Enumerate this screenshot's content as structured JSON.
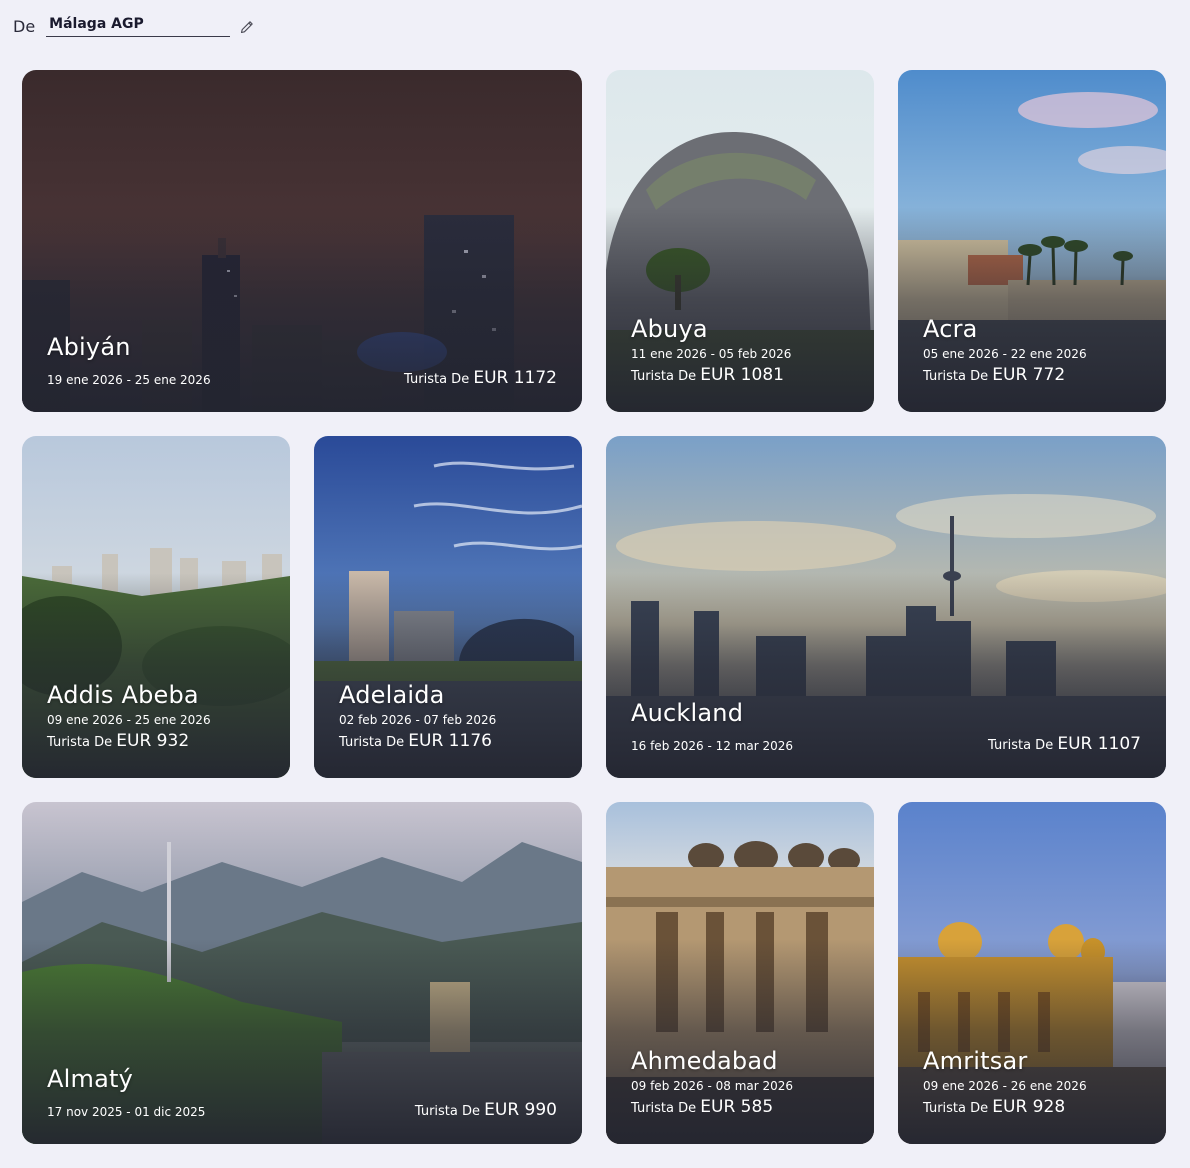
{
  "origin": {
    "label": "De",
    "value": "Málaga AGP"
  },
  "cards": [
    {
      "city": "Abiyán",
      "dates": "19 ene 2026 - 25 ene 2026",
      "fare_label": "Turista De",
      "price": "EUR 1172"
    },
    {
      "city": "Abuya",
      "dates": "11 ene 2026 - 05 feb 2026",
      "fare_label": "Turista De",
      "price": "EUR 1081"
    },
    {
      "city": "Acra",
      "dates": "05 ene 2026 - 22 ene 2026",
      "fare_label": "Turista De",
      "price": "EUR 772"
    },
    {
      "city": "Addis Abeba",
      "dates": "09 ene 2026 - 25 ene 2026",
      "fare_label": "Turista De",
      "price": "EUR 932"
    },
    {
      "city": "Adelaida",
      "dates": "02 feb 2026 - 07 feb 2026",
      "fare_label": "Turista De",
      "price": "EUR 1176"
    },
    {
      "city": "Auckland",
      "dates": "16 feb 2026 - 12 mar 2026",
      "fare_label": "Turista De",
      "price": "EUR 1107"
    },
    {
      "city": "Almatý",
      "dates": "17 nov 2025 - 01 dic 2025",
      "fare_label": "Turista De",
      "price": "EUR 990"
    },
    {
      "city": "Ahmedabad",
      "dates": "09 feb 2026 - 08 mar 2026",
      "fare_label": "Turista De",
      "price": "EUR 585"
    },
    {
      "city": "Amritsar",
      "dates": "09 ene 2026 - 26 ene 2026",
      "fare_label": "Turista De",
      "price": "EUR 928"
    }
  ]
}
